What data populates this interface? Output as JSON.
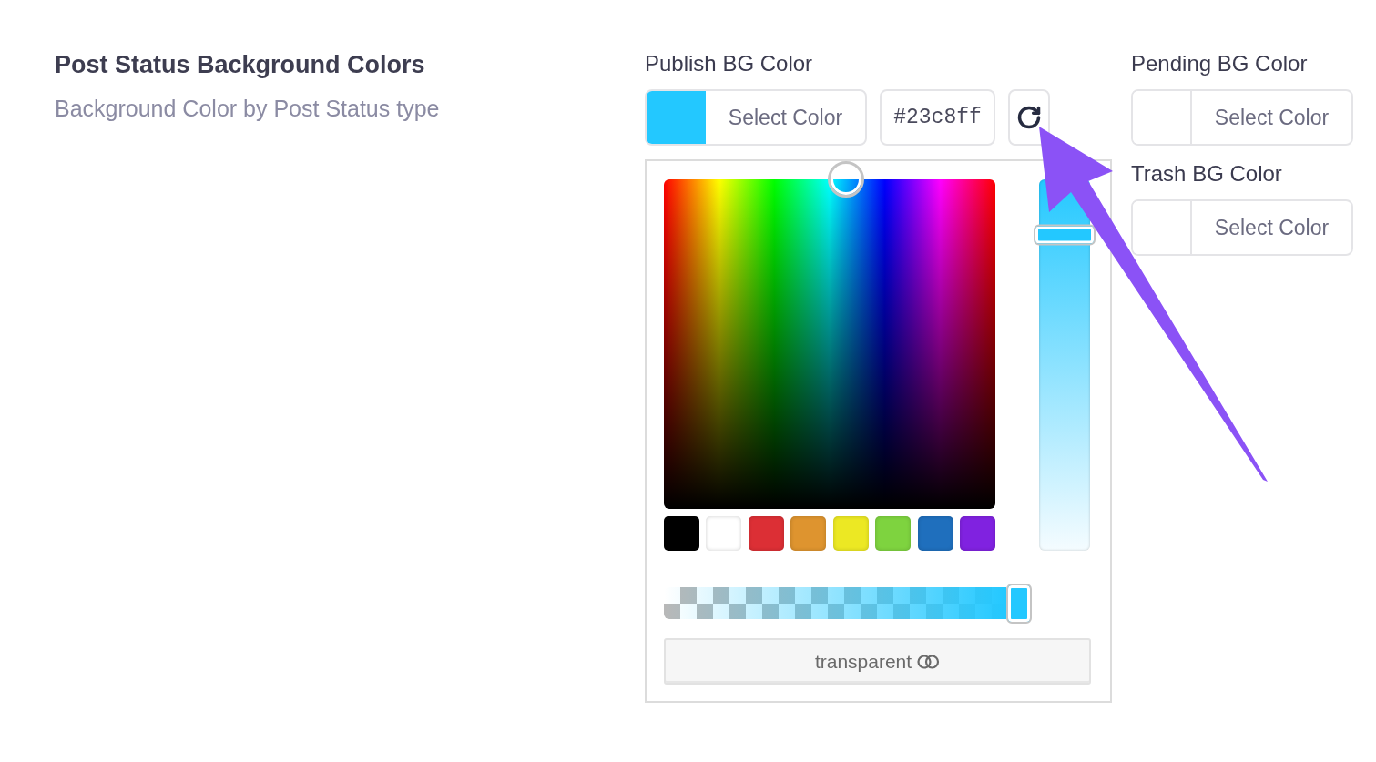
{
  "section": {
    "title": "Post Status Background Colors",
    "description": "Background Color by Post Status type"
  },
  "fields": [
    {
      "label": "Publish BG Color",
      "color": "#23c8ff",
      "button_label": "Select Color",
      "hex_value": "#23c8ff",
      "expanded": true
    },
    {
      "label": "Pending BG Color",
      "button_label": "Select Color",
      "expanded": false
    },
    {
      "label": "Trash BG Color",
      "button_label": "Select Color",
      "expanded": false
    }
  ],
  "color_picker": {
    "palette": {
      "level": 0.55
    },
    "shade_slider": {
      "level": 0.85
    },
    "swatches": [
      {
        "color": "#000000"
      },
      {
        "color": "#ffffff"
      },
      {
        "color": "#dc2f35"
      },
      {
        "color": "#de942f"
      },
      {
        "color": "#ece823"
      },
      {
        "color": "#7ed33f"
      },
      {
        "color": "#1f6fbd"
      },
      {
        "color": "#8022e0"
      }
    ],
    "alpha_slider": {
      "level": 1
    },
    "transparent_button": "transparent"
  }
}
